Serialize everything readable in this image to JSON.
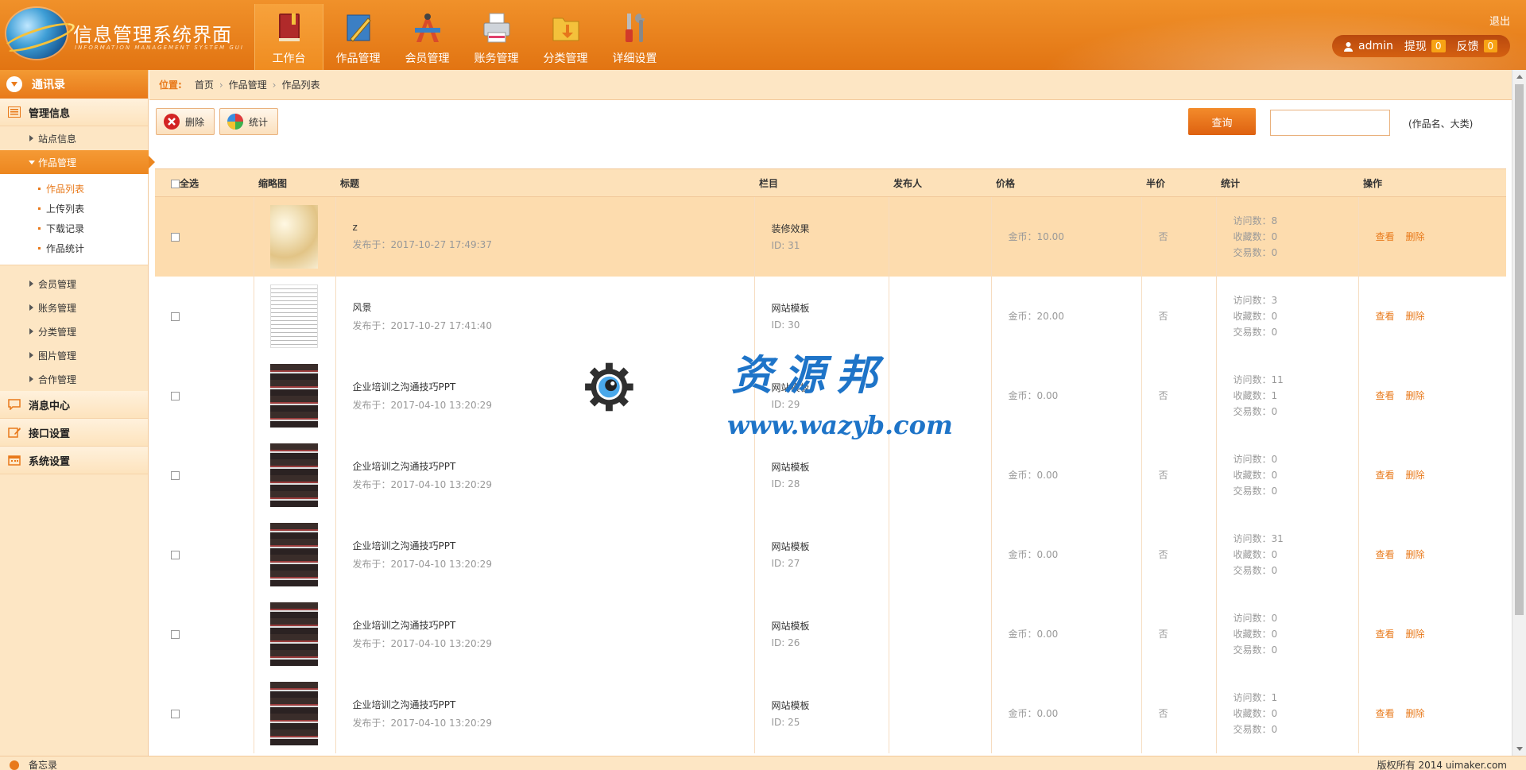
{
  "header": {
    "title": "信息管理系统界面",
    "subtitle": "INFORMATION MANAGEMENT SYSTEM GUI",
    "logout": "退出",
    "nav": [
      {
        "label": "工作台",
        "icon": "book-icon",
        "active": true
      },
      {
        "label": "作品管理",
        "icon": "pencil-ruler-icon",
        "active": false
      },
      {
        "label": "会员管理",
        "icon": "compass-icon",
        "active": false
      },
      {
        "label": "账务管理",
        "icon": "printer-icon",
        "active": false
      },
      {
        "label": "分类管理",
        "icon": "folder-download-icon",
        "active": false
      },
      {
        "label": "详细设置",
        "icon": "tools-icon",
        "active": false
      }
    ],
    "user": {
      "name": "admin",
      "withdraw_label": "提现",
      "withdraw_count": "0",
      "feedback_label": "反馈",
      "feedback_count": "0"
    }
  },
  "sidebar": {
    "top": "通讯录",
    "section_manage": "管理信息",
    "items_before": [
      {
        "label": "站点信息"
      }
    ],
    "active_item": "作品管理",
    "sub_items": [
      {
        "label": "作品列表",
        "active": true
      },
      {
        "label": "上传列表",
        "active": false
      },
      {
        "label": "下载记录",
        "active": false
      },
      {
        "label": "作品统计",
        "active": false
      }
    ],
    "items_after": [
      {
        "label": "会员管理"
      },
      {
        "label": "账务管理"
      },
      {
        "label": "分类管理"
      },
      {
        "label": "图片管理"
      },
      {
        "label": "合作管理"
      }
    ],
    "sections": [
      {
        "label": "消息中心",
        "icon": "message-icon"
      },
      {
        "label": "接口设置",
        "icon": "edit-icon"
      },
      {
        "label": "系统设置",
        "icon": "calendar-icon"
      }
    ]
  },
  "breadcrumb": {
    "label": "位置:",
    "items": [
      "首页",
      "作品管理",
      "作品列表"
    ]
  },
  "toolbar": {
    "delete_label": "删除",
    "stats_label": "统计"
  },
  "search": {
    "button": "查询",
    "placeholder": "",
    "value": "",
    "hint": "(作品名、大类)"
  },
  "table": {
    "headers": {
      "select_all": "全选",
      "thumb": "缩略图",
      "title": "标题",
      "column": "栏目",
      "publisher": "发布人",
      "price": "价格",
      "half": "半价",
      "stats": "统计",
      "ops": "操作"
    },
    "rows": [
      {
        "thumb": "a",
        "title": "z",
        "date": "发布于：2017-10-27 17:49:37",
        "column": "装修效果",
        "id": "ID: 31",
        "publisher": "",
        "price": "金币：10.00",
        "half": "否",
        "visits": "访问数：8",
        "fav": "收藏数：0",
        "deals": "交易数：0",
        "view": "查看",
        "del": "删除",
        "highlight": true
      },
      {
        "thumb": "b",
        "title": "风景",
        "date": "发布于：2017-10-27 17:41:40",
        "column": "网站模板",
        "id": "ID: 30",
        "publisher": "",
        "price": "金币：20.00",
        "half": "否",
        "visits": "访问数：3",
        "fav": "收藏数：0",
        "deals": "交易数：0",
        "view": "查看",
        "del": "删除",
        "highlight": false
      },
      {
        "thumb": "c",
        "title": "企业培训之沟通技巧PPT",
        "date": "发布于：2017-04-10 13:20:29",
        "column": "网站模板",
        "id": "ID: 29",
        "publisher": "",
        "price": "金币：0.00",
        "half": "否",
        "visits": "访问数：11",
        "fav": "收藏数：1",
        "deals": "交易数：0",
        "view": "查看",
        "del": "删除",
        "highlight": false
      },
      {
        "thumb": "c",
        "title": "企业培训之沟通技巧PPT",
        "date": "发布于：2017-04-10 13:20:29",
        "column": "网站模板",
        "id": "ID: 28",
        "publisher": "",
        "price": "金币：0.00",
        "half": "否",
        "visits": "访问数：0",
        "fav": "收藏数：0",
        "deals": "交易数：0",
        "view": "查看",
        "del": "删除",
        "highlight": false
      },
      {
        "thumb": "c",
        "title": "企业培训之沟通技巧PPT",
        "date": "发布于：2017-04-10 13:20:29",
        "column": "网站模板",
        "id": "ID: 27",
        "publisher": "",
        "price": "金币：0.00",
        "half": "否",
        "visits": "访问数：31",
        "fav": "收藏数：0",
        "deals": "交易数：0",
        "view": "查看",
        "del": "删除",
        "highlight": false
      },
      {
        "thumb": "c",
        "title": "企业培训之沟通技巧PPT",
        "date": "发布于：2017-04-10 13:20:29",
        "column": "网站模板",
        "id": "ID: 26",
        "publisher": "",
        "price": "金币：0.00",
        "half": "否",
        "visits": "访问数：0",
        "fav": "收藏数：0",
        "deals": "交易数：0",
        "view": "查看",
        "del": "删除",
        "highlight": false
      },
      {
        "thumb": "c",
        "title": "企业培训之沟通技巧PPT",
        "date": "发布于：2017-04-10 13:20:29",
        "column": "网站模板",
        "id": "ID: 25",
        "publisher": "",
        "price": "金币：0.00",
        "half": "否",
        "visits": "访问数：1",
        "fav": "收藏数：0",
        "deals": "交易数：0",
        "view": "查看",
        "del": "删除",
        "highlight": false
      }
    ]
  },
  "footer": {
    "left": "备忘录",
    "right": "版权所有 2014 uimaker.com"
  },
  "watermark": {
    "text": "资源邦",
    "url": "www.wazyb.com"
  },
  "colors": {
    "accent": "#e8791a",
    "header": "#e27412",
    "sidebar_bg": "#fde6c4",
    "row_highlight": "#fddcae",
    "watermark": "#1e74c8"
  }
}
